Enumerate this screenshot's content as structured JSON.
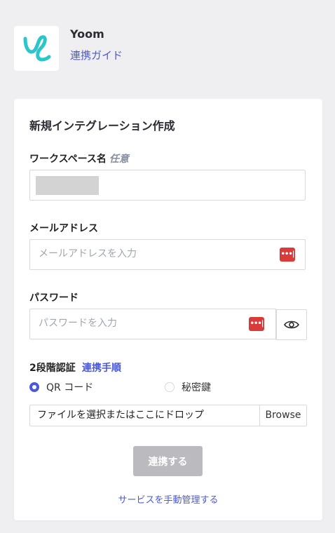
{
  "app": {
    "name": "Yoom",
    "guide_link": "連携ガイド"
  },
  "form": {
    "title": "新規インテグレーション作成",
    "workspace": {
      "label": "ワークスペース名",
      "optional": "任意",
      "value": ""
    },
    "email": {
      "label": "メールアドレス",
      "placeholder": "メールアドレスを入力"
    },
    "password": {
      "label": "パスワード",
      "placeholder": "パスワードを入力"
    },
    "twofa": {
      "label": "2段階認証",
      "link": "連携手順",
      "options": [
        {
          "label": "QR コード",
          "selected": true
        },
        {
          "label": "秘密鍵",
          "selected": false
        }
      ]
    },
    "file": {
      "text": "ファイルを選択またはここにドロップ",
      "browse": "Browse"
    },
    "submit": "連携する",
    "manual_link": "サービスを手動管理する"
  },
  "colors": {
    "accent": "#4a5ad6",
    "logo_teal": "#2bc6c9",
    "pw_manager_red": "#d93a3a",
    "disabled_button": "#bbbbbf"
  },
  "icons": {
    "logo": "yoom-logo",
    "pw_manager": "password-manager-icon",
    "eye": "eye-icon"
  }
}
